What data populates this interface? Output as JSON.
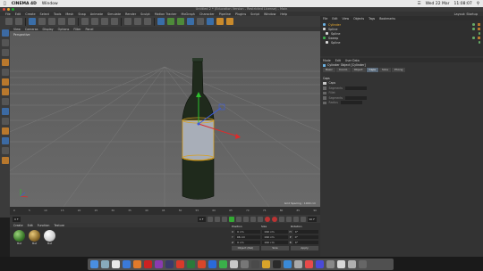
{
  "mac_menubar": {
    "app": "CINEMA 4D",
    "items": [
      "Window"
    ],
    "right": {
      "date": "Wed 22 Mar",
      "time": "11:08:07"
    }
  },
  "window_title": "Untitled 2 * (Education Version - Restricted License) - Main",
  "c4d_menu": [
    "File",
    "Edit",
    "Create",
    "Select",
    "Tools",
    "Mesh",
    "Snap",
    "Animate",
    "Simulate",
    "Render",
    "Sculpt",
    "Motion Tracker",
    "MoGraph",
    "Character",
    "Pipeline",
    "Plugins",
    "Script",
    "Window",
    "Help"
  ],
  "layout_label": "Layout: Startup",
  "viewport": {
    "menu": [
      "View",
      "Cameras",
      "Display",
      "Options",
      "Filter",
      "Panel"
    ],
    "camera": "Perspective",
    "grid_spacing": "Grid Spacing : 1000 cm"
  },
  "timeline": {
    "ticks": [
      "0",
      "5",
      "10",
      "15",
      "20",
      "25",
      "30",
      "35",
      "40",
      "45",
      "50",
      "55",
      "60",
      "65",
      "70",
      "75",
      "80",
      "85",
      "90"
    ],
    "start_frame": "0 F",
    "current_frame": "0 F",
    "end_frame": "90 F"
  },
  "material_manager": {
    "menu": [
      "Create",
      "Edit",
      "Function",
      "Texture"
    ],
    "materials": [
      {
        "label": "Mat",
        "color": "#3b7a2a"
      },
      {
        "label": "Mat",
        "color": "#8a6a2a"
      },
      {
        "label": "Mat",
        "color": "#d8d8d8"
      }
    ]
  },
  "coordinates": {
    "headers": [
      "Position",
      "Size",
      "Rotation"
    ],
    "rows": [
      {
        "axis": "X",
        "pos": "0 cm",
        "size": "190 cm",
        "rot_label": "H",
        "rot": "0°"
      },
      {
        "axis": "Y",
        "pos": "96 cm",
        "size": "190 cm",
        "rot_label": "P",
        "rot": "0°"
      },
      {
        "axis": "Z",
        "pos": "0 cm",
        "size": "190 cm",
        "rot_label": "B",
        "rot": "0°"
      }
    ],
    "mode": "Object (Rel)",
    "size_mode": "Size",
    "apply": "Apply"
  },
  "object_manager": {
    "tabs": [
      "File",
      "Edit",
      "View",
      "Objects",
      "Tags",
      "Bookmarks"
    ],
    "objects": [
      "Cylinder",
      "Spline",
      "Spline",
      "Sweep",
      "Spline"
    ]
  },
  "attributes": {
    "tabs_header": [
      "Mode",
      "Edit",
      "User Data"
    ],
    "title": "Cylinder Object [Cylinder]",
    "tabs": [
      "Basic",
      "Coord.",
      "Object",
      "Caps",
      "Slice",
      "Phong"
    ],
    "active_tab": "Caps",
    "section": "Caps",
    "rows": [
      {
        "label": "Caps",
        "checked": true
      },
      {
        "label": "Segments",
        "checked": false
      },
      {
        "label": "Fillet",
        "checked": false
      },
      {
        "label": "Segments",
        "checked": false
      },
      {
        "label": "Radius",
        "checked": false
      }
    ]
  },
  "dock_icons": [
    "#4a8ee0",
    "#8ab",
    "#e8e8e8",
    "#3b7ad8",
    "#e07a2a",
    "#c22",
    "#8a3ab0",
    "#3a3a6a",
    "#d83a2a",
    "#2a7a3a",
    "#d8462a",
    "#2a6ad8",
    "#3ab04a",
    "#c8c8c8",
    "#777",
    "#4a4a4a",
    "#d8a42a",
    "#2a2a2a",
    "#3a8ad8",
    "#aaa",
    "#e84a4a",
    "#4a4ad8",
    "#888",
    "#d8d8d8",
    "#b0b0b0",
    "#666"
  ]
}
